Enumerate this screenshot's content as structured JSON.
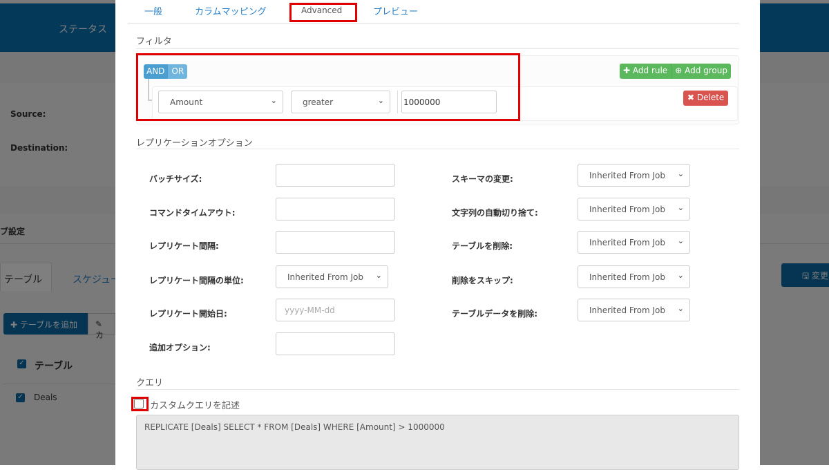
{
  "background": {
    "nav_status": "ステータス",
    "source_label": "Source:",
    "destination_label": "Destination:",
    "job_settings": "ブ設定",
    "tabs": [
      "テーブル",
      "スケジュー"
    ],
    "add_table": "テーブルを追加",
    "edit_prefix": "カ",
    "table_header": "テーブル",
    "rows": [
      "Deals"
    ],
    "save_button": "変更"
  },
  "tabs": [
    "一般",
    "カラムマッピング",
    "Advanced",
    "プレビュー"
  ],
  "active_tab": "Advanced",
  "filter": {
    "title": "フィルタ",
    "and": "AND",
    "or": "OR",
    "active_condition": "AND",
    "add_rule": "Add rule",
    "add_group": "Add group",
    "field": "Amount",
    "operator": "greater",
    "value": "1000000",
    "delete": "Delete"
  },
  "replication": {
    "title": "レプリケーションオプション",
    "left": [
      {
        "label": "バッチサイズ:",
        "value": ""
      },
      {
        "label": "コマンドタイムアウト:",
        "value": ""
      },
      {
        "label": "レプリケート間隔:",
        "value": ""
      },
      {
        "label": "レプリケート間隔の単位:",
        "select": "Inherited From Job"
      },
      {
        "label": "レプリケート開始日:",
        "placeholder": "yyyy-MM-dd"
      },
      {
        "label": "追加オプション:",
        "value": ""
      }
    ],
    "right": [
      {
        "label": "スキーマの変更:",
        "select": "Inherited From Job"
      },
      {
        "label": "文字列の自動切り捨て:",
        "select": "Inherited From Job"
      },
      {
        "label": "テーブルを削除:",
        "select": "Inherited From Job"
      },
      {
        "label": "削除をスキップ:",
        "select": "Inherited From Job"
      },
      {
        "label": "テーブルデータを削除:",
        "select": "Inherited From Job"
      }
    ]
  },
  "query": {
    "title": "クエリ",
    "custom_label": "カスタムクエリを記述",
    "custom_checked": false,
    "sql": "REPLICATE [Deals] SELECT * FROM [Deals] WHERE [Amount] > 1000000"
  },
  "colors": {
    "highlight": "#e00000",
    "success": "#5cb85c",
    "danger": "#d9534f",
    "and_or": "#5aa9d6"
  }
}
